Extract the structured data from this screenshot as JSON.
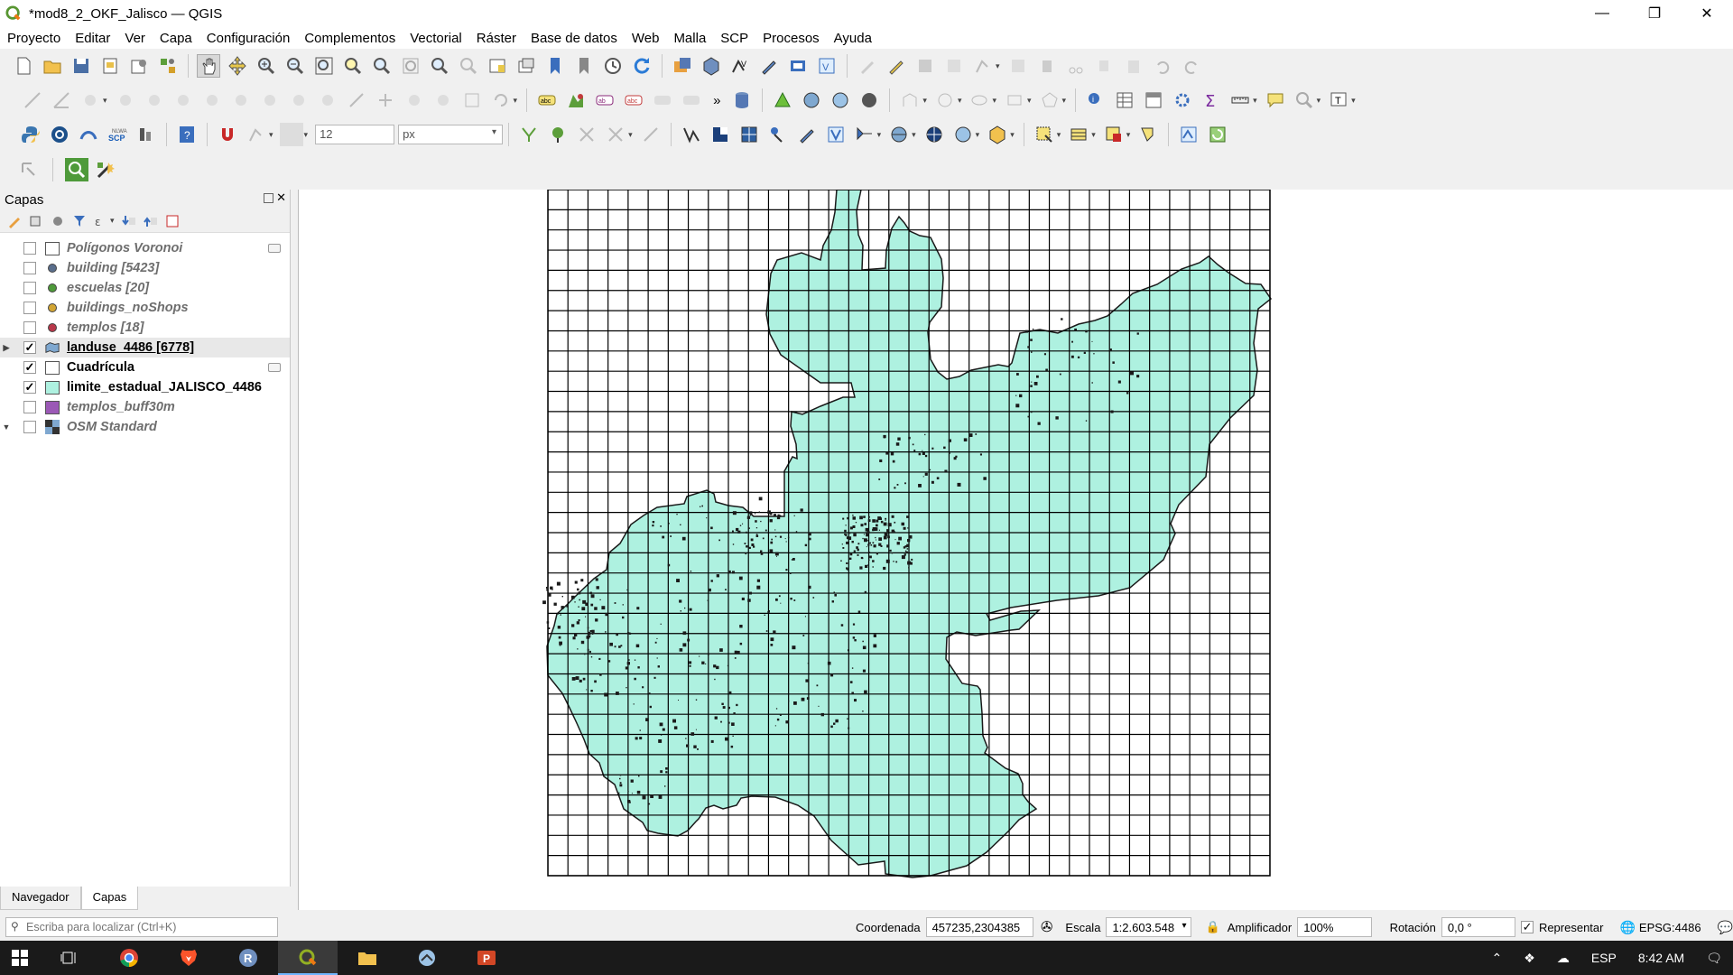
{
  "window": {
    "title": "*mod8_2_OKF_Jalisco — QGIS",
    "minimize": "—",
    "restore": "❐",
    "close": "✕"
  },
  "menu": [
    "Proyecto",
    "Editar",
    "Ver",
    "Capa",
    "Configuración",
    "Complementos",
    "Vectorial",
    "Ráster",
    "Base de datos",
    "Web",
    "Malla",
    "SCP",
    "Procesos",
    "Ayuda"
  ],
  "toolbar3": {
    "font_size_value": "12",
    "unit_value": "px",
    "scp_label": "SCP",
    "nlwa_label": "NLWA"
  },
  "layers_panel": {
    "title": "Capas",
    "layers": [
      {
        "name": "Polígonos Voronoi",
        "checked": false,
        "symbol": "box",
        "color": "#ffffff"
      },
      {
        "name": "building [5423]",
        "checked": false,
        "symbol": "dot",
        "color": "#5a6e8c"
      },
      {
        "name": "escuelas [20]",
        "checked": false,
        "symbol": "dot",
        "color": "#4e9a3a"
      },
      {
        "name": "buildings_noShops",
        "checked": false,
        "symbol": "dot",
        "color": "#d2a534"
      },
      {
        "name": "templos [18]",
        "checked": false,
        "symbol": "dot",
        "color": "#b8374a"
      },
      {
        "name": "landuse_4486 [6778]",
        "checked": true,
        "symbol": "group",
        "color": "#7fa8d0"
      },
      {
        "name": "Cuadrícula",
        "checked": true,
        "symbol": "box",
        "color": "#ffffff"
      },
      {
        "name": "limite_estadual_JALISCO_4486",
        "checked": true,
        "symbol": "box",
        "color": "#aef1e0"
      },
      {
        "name": "templos_buff30m",
        "checked": false,
        "symbol": "box",
        "color": "#9b59b6"
      },
      {
        "name": "OSM Standard",
        "checked": false,
        "symbol": "raster",
        "color": "#333333"
      }
    ],
    "tabs": [
      "Navegador",
      "Capas"
    ]
  },
  "map": {
    "polygon_fill": "#aef1e0",
    "grid_color": "#000000"
  },
  "statusbar": {
    "locator_placeholder": "Escriba para localizar (Ctrl+K)",
    "coord_label": "Coordenada",
    "coord_value": "457235,2304385",
    "scale_label": "Escala",
    "scale_value": "1:2.603.548",
    "magnifier_label": "Amplificador",
    "magnifier_value": "100%",
    "rotation_label": "Rotación",
    "rotation_value": "0,0 °",
    "render_label": "Representar",
    "crs_value": "EPSG:4486"
  },
  "taskbar": {
    "lang": "ESP",
    "time": "8:42 AM"
  }
}
